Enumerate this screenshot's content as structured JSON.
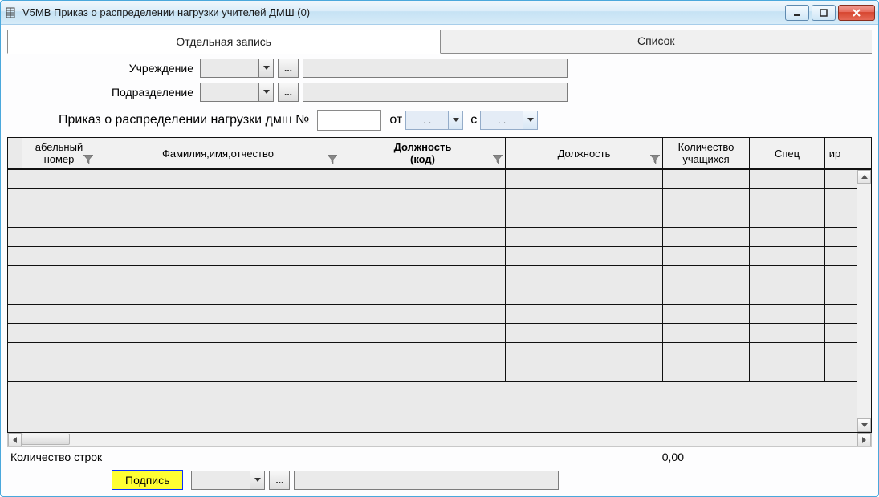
{
  "window": {
    "title": "V5MB Приказ о распределении нагрузки учителей ДМШ (0)"
  },
  "tabs": {
    "single": "Отдельная запись",
    "list": "Список"
  },
  "form": {
    "institution_label": "Учреждение",
    "department_label": "Подразделение",
    "institution_value": "",
    "institution_text": "",
    "department_value": "",
    "department_text": "",
    "order_line_prefix": "Приказ о распределении нагрузки дмш №",
    "order_no": "",
    "from_label": "от",
    "date_from": " .  .",
    "with_label": "с",
    "date_with": " .  ."
  },
  "grid": {
    "columns": [
      {
        "label_line1": "абельный",
        "label_line2": "номер",
        "filter": true,
        "bold": false
      },
      {
        "label_line1": "Фамилия,имя,отчество",
        "label_line2": "",
        "filter": true,
        "bold": false
      },
      {
        "label_line1": "Должность",
        "label_line2": "(код)",
        "filter": true,
        "bold": true
      },
      {
        "label_line1": "Должность",
        "label_line2": "",
        "filter": true,
        "bold": false
      },
      {
        "label_line1": "Количество",
        "label_line2": "учащихся",
        "filter": false,
        "bold": false
      },
      {
        "label_line1": "Спец",
        "label_line2": "",
        "filter": false,
        "bold": false
      },
      {
        "label_line1": "ир",
        "label_line2": "",
        "filter": false,
        "bold": false
      }
    ],
    "empty_rows": 11
  },
  "footer": {
    "rowcount_label": "Количество строк",
    "total_value": "0,00"
  },
  "sign": {
    "button": "Подпись",
    "value": "",
    "text": ""
  }
}
